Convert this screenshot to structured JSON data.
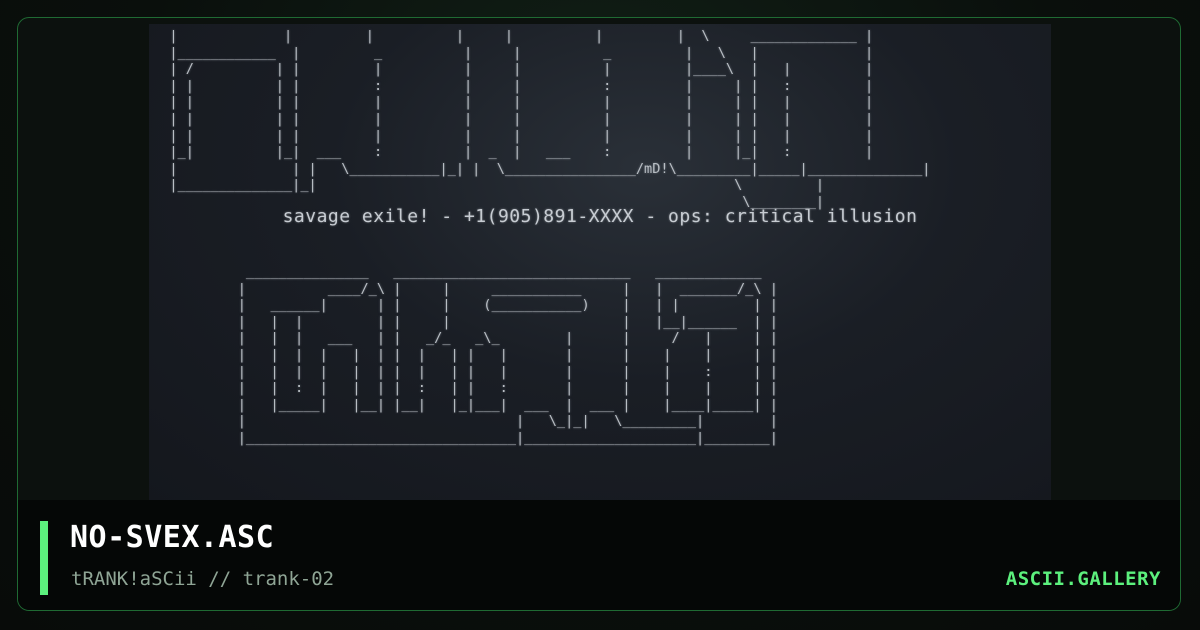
{
  "artwork": {
    "tagline": "savage exile!  -  +1(905)891-XXXX  -  ops: critical illusion",
    "art_top": "  |             |         |          |     |          |         |  \\     _____________ |\n  |____________  |         _          |     |          _         |   \\   |             |\n  | /          | |         |          |     |          |         |____\\  |   |         |\n  | |          | |         :          |     |          :         |     | |   :         |\n  | |          | |         |          |     |          |         |     | |   |         |\n  | |          | |         |          |     |          |         |     | |   |         |\n  | |          | |         |          |     |          |         |     | |   |         |\n  |_|          |_|  ___    :          |  _  |   ___    :         |     |_|   :         |\n  |              | |   \\___________|_| |  \\________________/mD!\\_________|_____|______________|\n  |______________|_|                                                   \\         |\n                                                                        \\________|",
    "art_bottom": "     _______________   _____________________________   _____________\n    |          ____/_\\ |     |     ___________     |   |  _______/_\\ |\n    |   ______|      | |     |    (___________)    |   | |         | |\n    |   |  |         | |     |                     |   |__|______  | |\n    |   |  |   ___   | |   _/_   _\\_        |      |     /   |     | |\n    |   |  |  |   |  | |  |   | |   |       |      |    |    |     | |\n    |   |  |  |   |  | |  |   | |   |       |      |    |    :     | |\n    |   |  :  |   |  | |  :   | |   :       |      |    |    |     | |\n    |   |_____|   |__| |__|   |_|___|  ___  |  ___ |    |____|_____| |\n    |                                 |   \\_|_|   \\_________|        |\n    |_________________________________|_____________________|________|"
  },
  "footer": {
    "title": "NO-SVEX.ASC",
    "subtitle": "tRANK!aSCii // trank-02",
    "brand": "ASCII.GALLERY"
  },
  "colors": {
    "accent": "#5cf07d",
    "frame_border": "#1f6a33",
    "art_text": "#b9bec4",
    "footer_bg": "#050706"
  }
}
